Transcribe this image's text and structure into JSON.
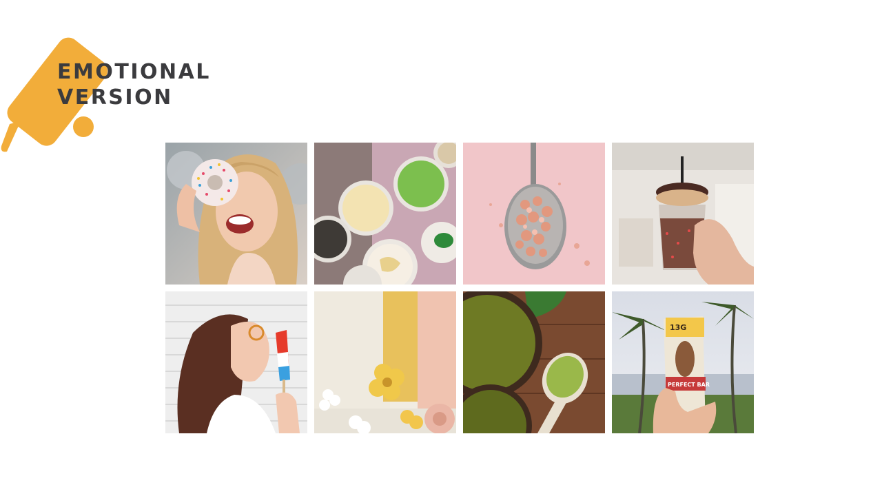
{
  "title": {
    "line1": "EMOTIONAL",
    "line2": "VERSION"
  },
  "colors": {
    "accent": "#F2AD3A",
    "title_text": "#3B3B3E"
  },
  "photos": [
    {
      "subject": "woman holding sprinkled donut"
    },
    {
      "subject": "bowls of ice cream and matcha"
    },
    {
      "subject": "spoon of pink himalayan salt"
    },
    {
      "subject": "iced chocolate drink with donut"
    },
    {
      "subject": "woman eating popsicle"
    },
    {
      "subject": "folded felt with paper flowers"
    },
    {
      "subject": "matcha tea and powder on wood"
    },
    {
      "subject": "hand holding protein bar under palm trees"
    }
  ],
  "protein_bar": {
    "brand": "PERFECT BAR",
    "protein": "13G"
  }
}
